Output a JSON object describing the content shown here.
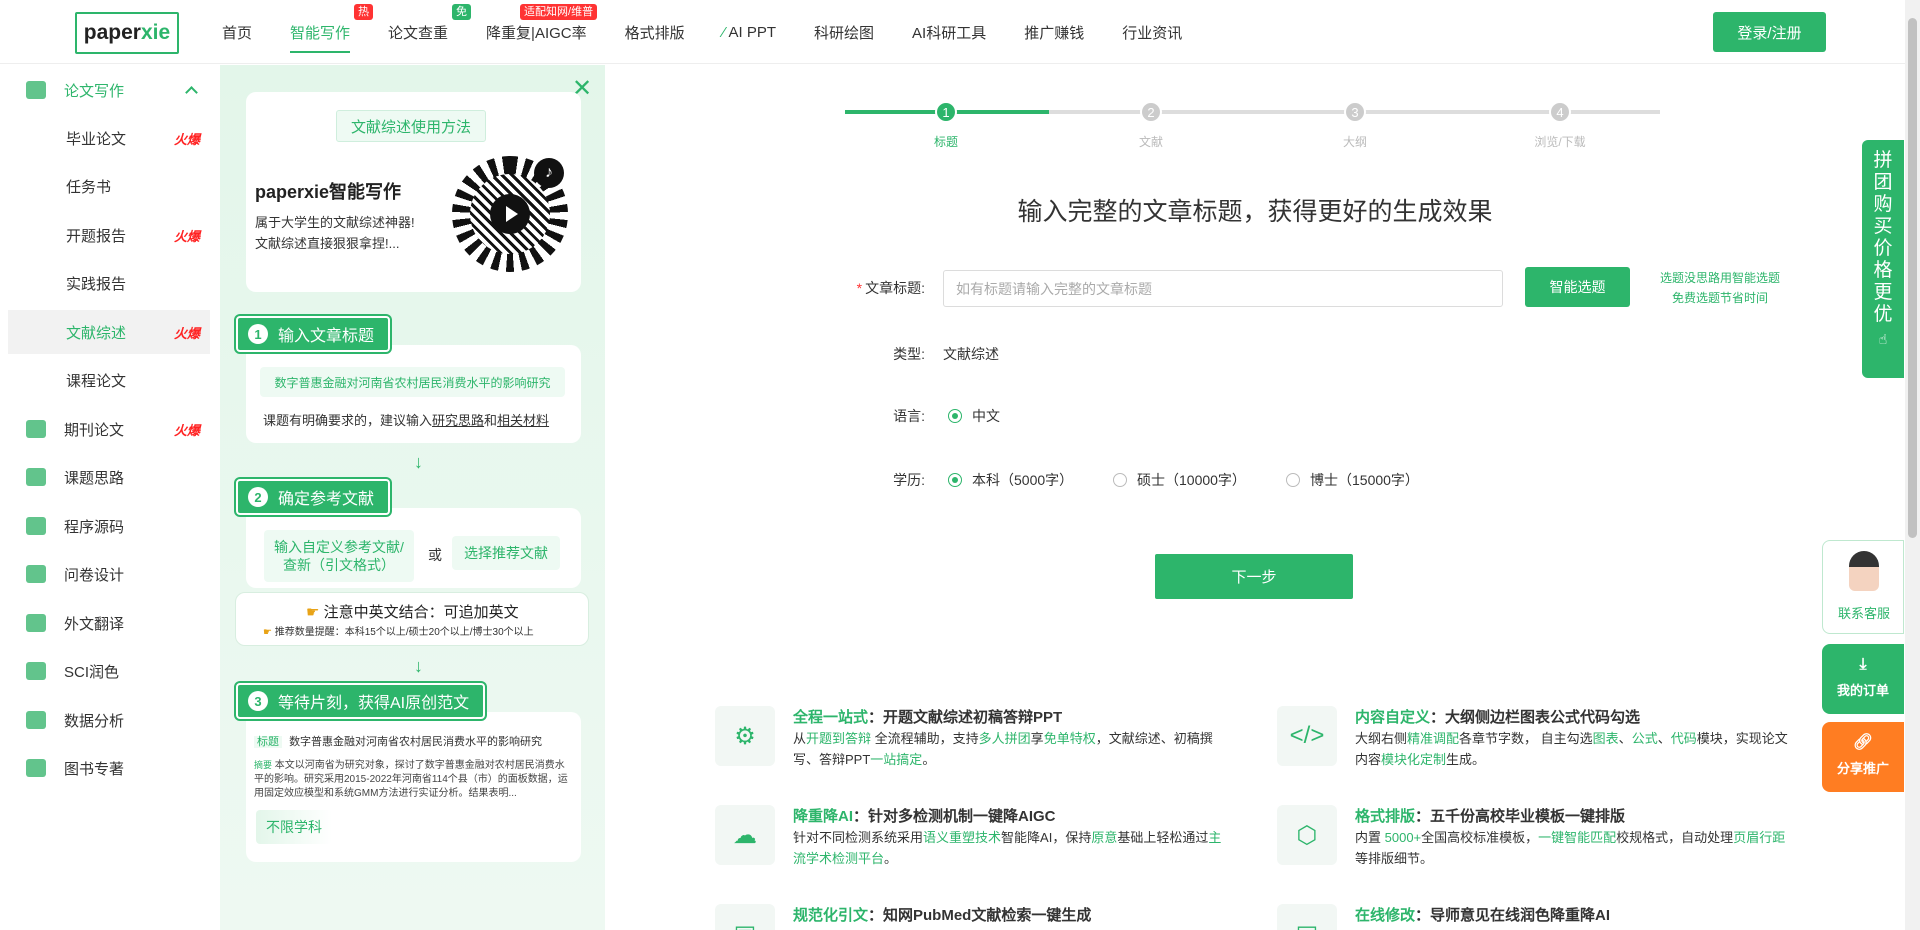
{
  "header": {
    "logo_main": "paper",
    "logo_accent": "xie",
    "nav": [
      {
        "label": "首页",
        "badge": ""
      },
      {
        "label": "智能写作",
        "badge": "热"
      },
      {
        "label": "论文查重",
        "badge": "免"
      },
      {
        "label": "降重复|AIGC率",
        "badge": "适配知网/维普"
      },
      {
        "label": "格式排版",
        "badge": ""
      },
      {
        "label": "AI PPT",
        "badge": ""
      },
      {
        "label": "科研绘图",
        "badge": ""
      },
      {
        "label": "AI科研工具",
        "badge": ""
      },
      {
        "label": "推广赚钱",
        "badge": ""
      },
      {
        "label": "行业资讯",
        "badge": ""
      }
    ],
    "login_label": "登录/注册"
  },
  "sidebar": {
    "group_label": "论文写作",
    "items": [
      {
        "label": "毕业论文",
        "hot": "火爆"
      },
      {
        "label": "任务书",
        "hot": ""
      },
      {
        "label": "开题报告",
        "hot": "火爆"
      },
      {
        "label": "实践报告",
        "hot": ""
      },
      {
        "label": "文献综述",
        "hot": "火爆"
      },
      {
        "label": "课程论文",
        "hot": ""
      },
      {
        "label": "期刊论文",
        "hot": "火爆"
      },
      {
        "label": "课题思路",
        "hot": ""
      },
      {
        "label": "程序源码",
        "hot": ""
      },
      {
        "label": "问卷设计",
        "hot": ""
      },
      {
        "label": "外文翻译",
        "hot": ""
      },
      {
        "label": "SCI润色",
        "hot": ""
      },
      {
        "label": "数据分析",
        "hot": ""
      },
      {
        "label": "图书专著",
        "hot": ""
      }
    ]
  },
  "guide": {
    "method_label": "文献综述使用方法",
    "brand_title": "paperxie智能写作",
    "brand_desc_1": "属于大学生的文献综述神器!",
    "brand_desc_2": "文献综述直接狠狠拿捏!...",
    "step1_num": "1",
    "step1_title": "输入文章标题",
    "step1_example": "数字普惠金融对河南省农村居民消费水平的影响研究",
    "step1_tip_a": "课题有明确要求的，建议输入",
    "step1_tip_b": "研究思路",
    "step1_tip_c": "和",
    "step1_tip_d": "相关材料",
    "step2_num": "2",
    "step2_title": "确定参考文献",
    "step2_custom": "输入自定义参考文献/查新（引文格式）",
    "step2_or": "或",
    "step2_recommend": "选择推荐文献",
    "step2_note": "注意中英文结合：可追加英文",
    "step2_subnote": "推荐数量提醒：本科15个以上/硕士20个以上/博士30个以上",
    "step3_num": "3",
    "step3_title": "等待片刻，获得AI原创范文",
    "step3_tag_title": "标题",
    "step3_title_text": "数字普惠金融对河南省农村居民消费水平的影响研究",
    "step3_tag_abstract": "摘要",
    "step3_abstract": "本文以河南省为研究对象，探讨了数字普惠金融对农村居民消费水平的影响。研究采用2015-2022年河南省114个县（市）的面板数据，运用固定效应模型和系统GMM方法进行实证分析。结果表明...",
    "step3_subject": "不限学科"
  },
  "stepper": {
    "steps": [
      {
        "num": "1",
        "label": "标题"
      },
      {
        "num": "2",
        "label": "文献"
      },
      {
        "num": "3",
        "label": "大纲"
      },
      {
        "num": "4",
        "label": "浏览/下载"
      }
    ],
    "progress": 0.25
  },
  "form": {
    "heading": "输入完整的文章标题，获得更好的生成效果",
    "title_label": "文章标题:",
    "title_required": "*",
    "title_placeholder": "如有标题请输入完整的文章标题",
    "smart_btn": "智能选题",
    "hint_1": "选题没思路用智能选题",
    "hint_2": "免费选题节省时间",
    "type_label": "类型:",
    "type_value": "文献综述",
    "lang_label": "语言:",
    "lang_value": "中文",
    "degree_label": "学历:",
    "degree_options": [
      "本科（5000字）",
      "硕士（10000字）",
      "博士（15000字）"
    ],
    "next_btn": "下一步"
  },
  "features": [
    {
      "title_g": "全程一站式",
      "title": "：开题文献综述初稿答辩PPT",
      "d1": "从",
      "d2": "开题到答辩",
      "d3": " 全流程辅助，支持",
      "d4": "多人拼团",
      "d5": "享",
      "d6": "免单特权",
      "d7": "，文献综述、初稿撰写、答辩PPT",
      "d8": "一站搞定",
      "d9": "。"
    },
    {
      "title_g": "内容自定义",
      "title": "：大纲侧边栏图表公式代码勾选",
      "d1": "大纲右侧",
      "d2": "精准调配",
      "d3": "各章节字数，  自主勾选",
      "d4": "图表",
      "d5": "、",
      "d6": "公式",
      "d7": "、",
      "d8": "代码",
      "d9": "模块，实现论文内容",
      "d10": "模块化定制",
      "d11": "生成。"
    },
    {
      "title_g": "降重降AI",
      "title": "：针对多检测机制一键降AIGC",
      "d1": "针对不同检测系统采用",
      "d2": "语义重塑技术",
      "d3": "智能降AI，保持",
      "d4": "原意",
      "d5": "基础上轻松通过",
      "d6": "主流学术检测平台",
      "d7": "。"
    },
    {
      "title_g": "格式排版",
      "title": "：五千份高校毕业模板一键排版",
      "d1": "内置 ",
      "d2": "5000+",
      "d3": "全国高校标准模板，",
      "d4": "一键智能匹配",
      "d5": "校规格式，自动处理",
      "d6": "页眉行距",
      "d7": "等排版细节。"
    },
    {
      "title_g": "规范化引文",
      "title": "：知网PubMed文献检索一键生成"
    },
    {
      "title_g": "在线修改",
      "title": "：导师意见在线润色降重降AI"
    }
  ],
  "floats": {
    "group_buy": "拼团购买价格更优",
    "service": "联系客服",
    "orders": "我的订单",
    "share": "分享推广"
  },
  "colors": {
    "accent": "#2db56b",
    "hot": "#ff2222",
    "share": "#ff7d22"
  }
}
